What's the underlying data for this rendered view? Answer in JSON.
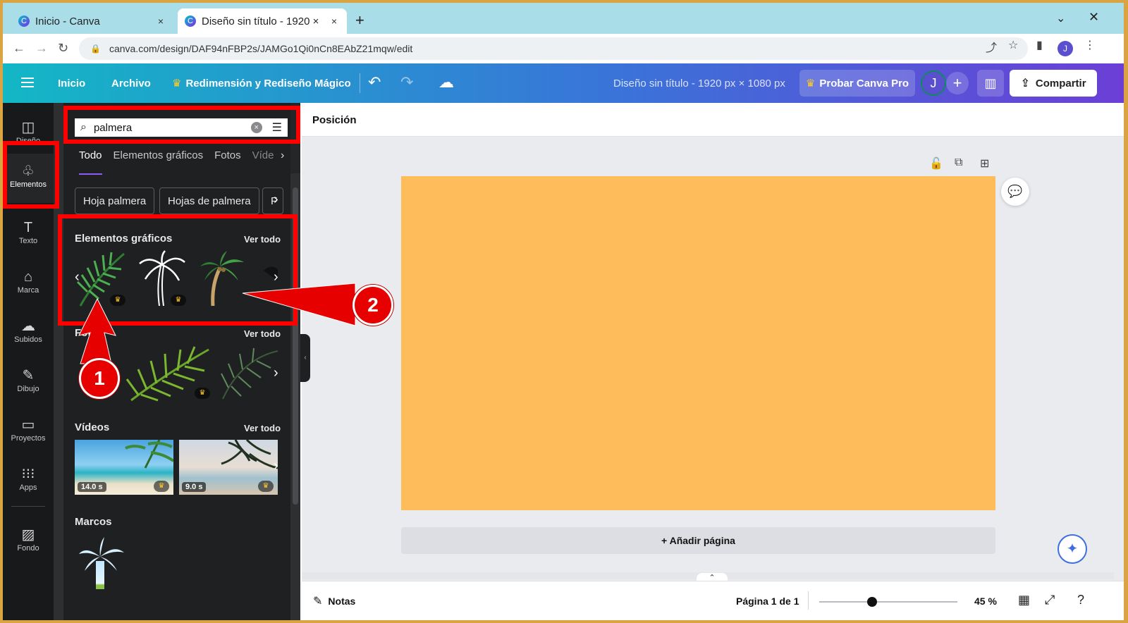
{
  "browser": {
    "tabs": [
      {
        "title": "Inicio - Canva",
        "close": "×"
      },
      {
        "title": "Diseño sin título - 1920 ×",
        "close": "×"
      }
    ],
    "new_tab": "+",
    "url": "canva.com/design/DAF94nFBP2s/JAMGo1Qi0nCn8EAbZ21mqw/edit",
    "profile_initial": "J"
  },
  "header": {
    "home": "Inicio",
    "file": "Archivo",
    "magic_resize": "Redimensión y Rediseño Mágico",
    "doc_title": "Diseño sin título - 1920 px × 1080 px",
    "try_pro": "Probar Canva Pro",
    "avatar": "J",
    "share": "Compartir"
  },
  "rail": {
    "items": [
      {
        "label": "Diseño",
        "icon": "layout-icon"
      },
      {
        "label": "Elementos",
        "icon": "shapes-icon"
      },
      {
        "label": "Texto",
        "icon": "text-icon"
      },
      {
        "label": "Marca",
        "icon": "brand-icon"
      },
      {
        "label": "Subidos",
        "icon": "upload-icon"
      },
      {
        "label": "Dibujo",
        "icon": "draw-icon"
      },
      {
        "label": "Proyectos",
        "icon": "folder-icon"
      },
      {
        "label": "Apps",
        "icon": "apps-icon"
      },
      {
        "label": "Fondo",
        "icon": "background-icon"
      }
    ]
  },
  "panel": {
    "search_value": "palmera",
    "tabs": [
      "Todo",
      "Elementos gráficos",
      "Fotos",
      "Víde"
    ],
    "chips": [
      "Hoja palmera",
      "Hojas de palmera",
      "F"
    ],
    "sections": {
      "graphics": {
        "title": "Elementos gráficos",
        "more": "Ver todo"
      },
      "photos": {
        "title": "Fot",
        "more": "Ver todo"
      },
      "videos": {
        "title": "Vídeos",
        "more": "Ver todo",
        "durations": [
          "14.0 s",
          "9.0 s"
        ]
      },
      "frames": {
        "title": "Marcos"
      }
    }
  },
  "annotations": {
    "callout_1": "1",
    "callout_2": "2"
  },
  "editor": {
    "context_label": "Posición",
    "add_page": "+ Añadir página",
    "canvas_color": "#ffbc5a"
  },
  "footer": {
    "notes": "Notas",
    "page_info": "Página 1 de 1",
    "zoom": "45 %"
  },
  "colors": {
    "accent": "#8b5cf6",
    "annotation_red": "#ff0000",
    "canvas": "#ffbc5a"
  }
}
